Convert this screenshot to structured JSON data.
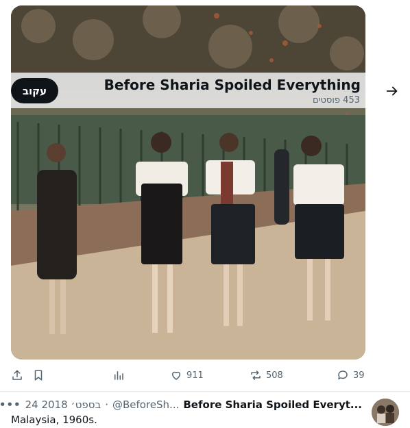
{
  "community": {
    "title": "Before Sharia Spoiled Everything",
    "post_count": "453 פוסטים",
    "follow_label": "עקוב"
  },
  "actions": {
    "replies": "39",
    "reposts": "508",
    "likes": "911"
  },
  "tweet": {
    "author_name": "Before Sharia Spoiled Everyt...",
    "handle": "@BeforeSh...",
    "separator": "·",
    "date": "24 בספט׳ 2018",
    "more": "•••",
    "text": "Malaysia, 1960s."
  },
  "colors": {
    "text_primary": "#0f1419",
    "text_secondary": "#536471",
    "button_dark": "#0f1419"
  }
}
